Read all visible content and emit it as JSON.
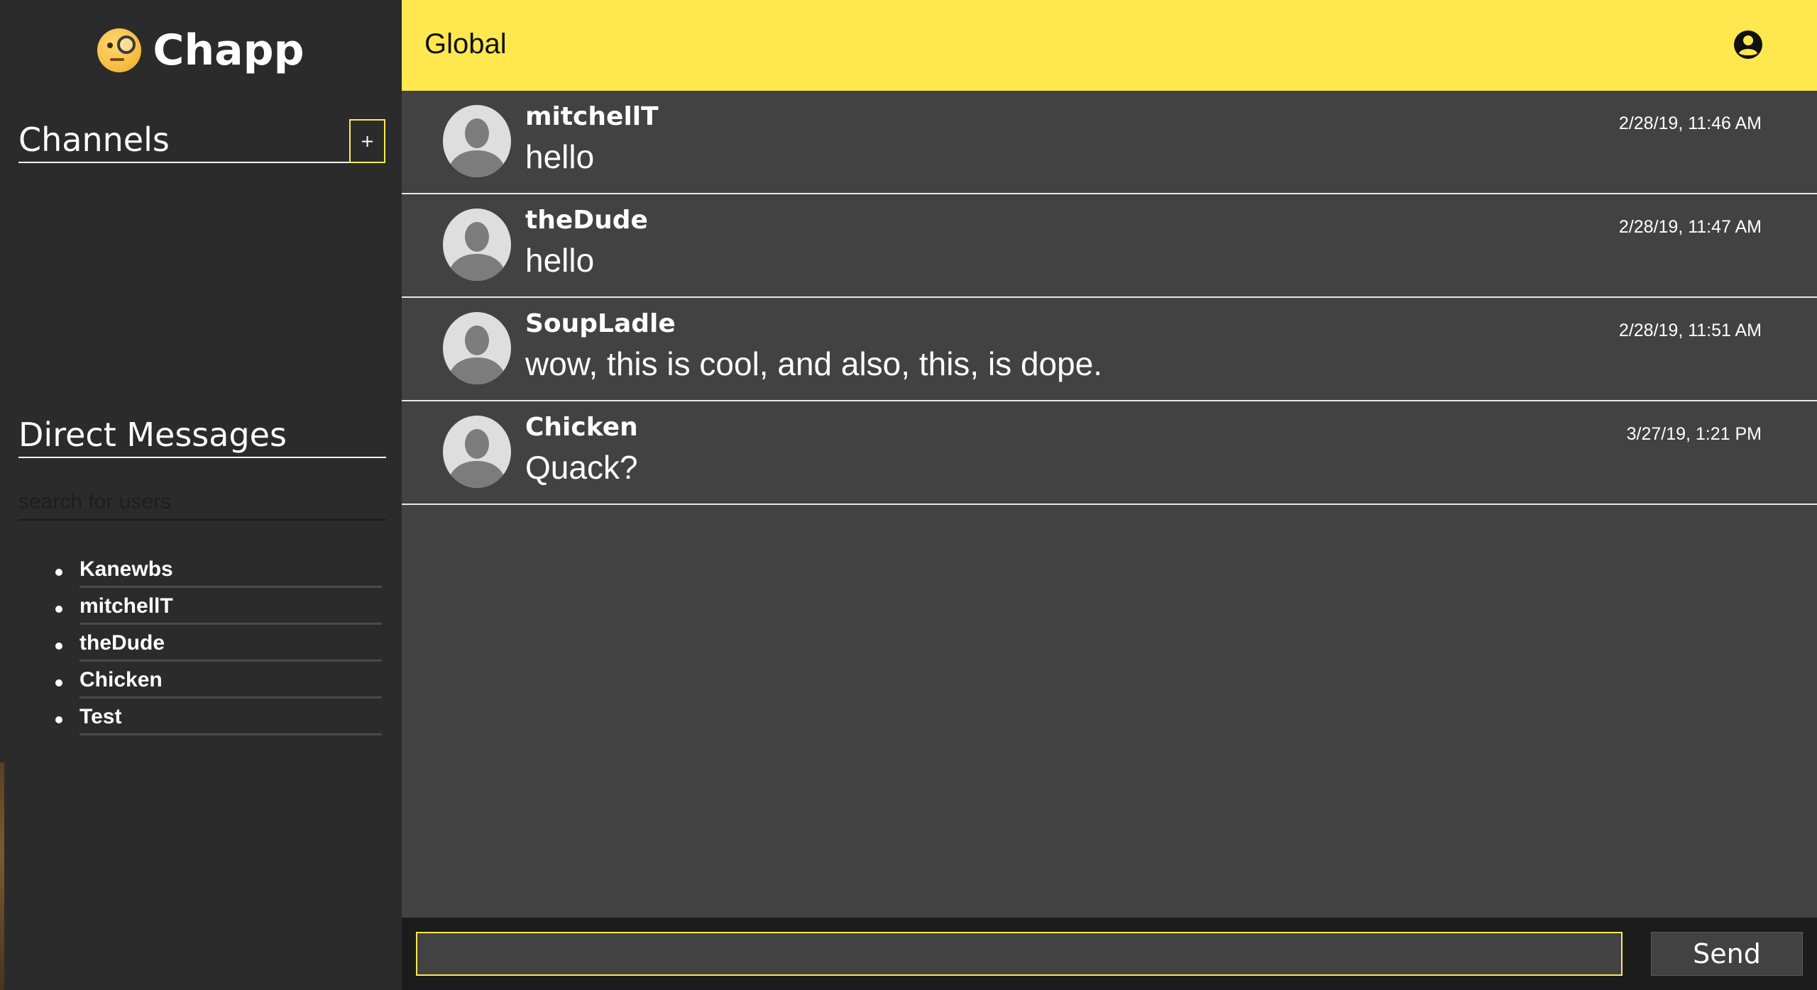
{
  "brand": {
    "name": "Chapp",
    "logo_icon": "monocle-face-emoji-icon"
  },
  "sidebar": {
    "channels_title": "Channels",
    "add_channel_label": "+",
    "direct_messages_title": "Direct Messages",
    "search_placeholder": "search for users",
    "users": [
      {
        "label": "Kanewbs"
      },
      {
        "label": "mitchellT"
      },
      {
        "label": "theDude"
      },
      {
        "label": "Chicken"
      },
      {
        "label": "Test"
      }
    ]
  },
  "header": {
    "title": "Global",
    "account_icon": "account-circle-icon"
  },
  "messages": [
    {
      "user": "mitchellT",
      "text": "hello",
      "time": "2/28/19, 11:46 AM",
      "avatar_icon": "default-avatar-icon"
    },
    {
      "user": "theDude",
      "text": "hello",
      "time": "2/28/19, 11:47 AM",
      "avatar_icon": "default-avatar-icon"
    },
    {
      "user": "SoupLadle",
      "text": "wow, this is cool, and also, this, is dope.",
      "time": "2/28/19, 11:51 AM",
      "avatar_icon": "default-avatar-icon"
    },
    {
      "user": "Chicken",
      "text": "Quack?",
      "time": "3/27/19, 1:21 PM",
      "avatar_icon": "default-avatar-icon"
    }
  ],
  "composer": {
    "value": "",
    "send_label": "Send"
  },
  "colors": {
    "accent": "#ffe84f",
    "sidebar_bg": "#2b2b2b",
    "main_bg": "#424242",
    "composer_bg": "#1c1c1c"
  }
}
